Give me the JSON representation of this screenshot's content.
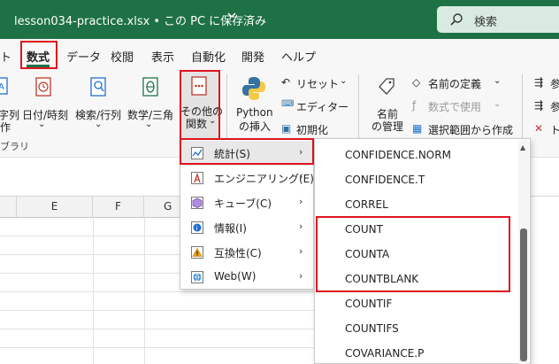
{
  "window": {
    "filename": "lesson034-practice.xlsx",
    "separator": "•",
    "save_status": "この PC に保存済み",
    "search_label": "検索"
  },
  "tabs": [
    {
      "label": "ト"
    },
    {
      "label": "数式"
    },
    {
      "label": "データ"
    },
    {
      "label": "校閲"
    },
    {
      "label": "表示"
    },
    {
      "label": "自動化"
    },
    {
      "label": "開発"
    },
    {
      "label": "ヘルプ"
    }
  ],
  "ribbon": {
    "text_fragment_1": "字列",
    "text_fragment_2": "作",
    "datetime": "日付/時刻",
    "lookup": "検索/行列",
    "math": "数学/三角",
    "more_functions_line1": "その他の",
    "more_functions_line2": "関数",
    "python_line1": "Python",
    "python_line2": "の挿入",
    "reset": "リセット",
    "editor": "エディター",
    "initialize": "初期化",
    "name_manager_line1": "名前",
    "name_manager_line2": "の管理",
    "define_name": "名前の定義",
    "use_in_formula": "数式で使用",
    "create_from_selection": "選択範囲から作成",
    "trace_1": "参",
    "trace_2": "参",
    "trace_3": "ト",
    "group_label": "ブラリ"
  },
  "columns": [
    "E",
    "F",
    "G"
  ],
  "menu": {
    "items": [
      {
        "label": "統計(S)",
        "icon": "statistics-icon"
      },
      {
        "label": "エンジニアリング(E)",
        "icon": "engineering-icon"
      },
      {
        "label": "キューブ(C)",
        "icon": "cube-icon"
      },
      {
        "label": "情報(I)",
        "icon": "information-icon"
      },
      {
        "label": "互換性(C)",
        "icon": "compatibility-icon"
      },
      {
        "label": "Web(W)",
        "icon": "web-icon"
      }
    ]
  },
  "functions": [
    "CONFIDENCE.NORM",
    "CONFIDENCE.T",
    "CORREL",
    "COUNT",
    "COUNTA",
    "COUNTBLANK",
    "COUNTIF",
    "COUNTIFS",
    "COVARIANCE.P"
  ],
  "colors": {
    "titlebar": "#1e7145",
    "highlight": "#e0141e"
  }
}
